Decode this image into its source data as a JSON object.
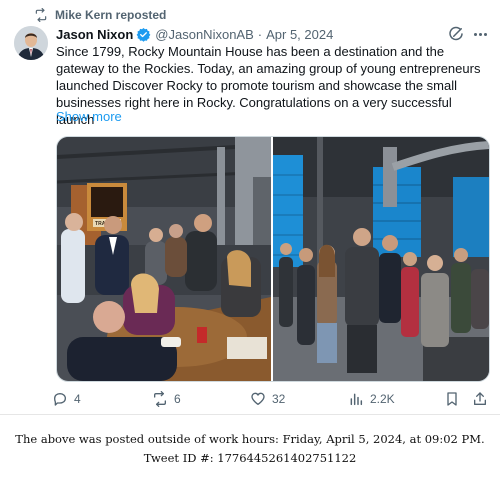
{
  "repost": {
    "label": "Mike Kern reposted",
    "icon": "repost-icon"
  },
  "author": {
    "name": "Jason Nixon",
    "handle": "@JasonNixonAB",
    "separator": "·",
    "date": "Apr 5, 2024",
    "verified_icon": "verified-badge-icon"
  },
  "tweet": {
    "text": "Since 1799, Rocky Mountain House has been a destination and the gateway to the Rockies. Today, an amazing group of young entrepreneurs launched Discover Rocky to promote tourism and showcase the small businesses right here in Rocky. Congratulations on a very successful launch",
    "show_more": "Show more"
  },
  "media": {
    "sign_text": "TRAPPER"
  },
  "actions": {
    "replies": "4",
    "reposts": "6",
    "likes": "32",
    "views": "2.2K"
  },
  "caption": {
    "line1": "The above was posted outside of work hours: Friday, April 5, 2024, at 09:02 PM.",
    "line2": "Tweet ID #: 1776445261402751122"
  },
  "colors": {
    "accent": "#1d9bf0",
    "muted": "#536471",
    "text": "#0f1419"
  }
}
